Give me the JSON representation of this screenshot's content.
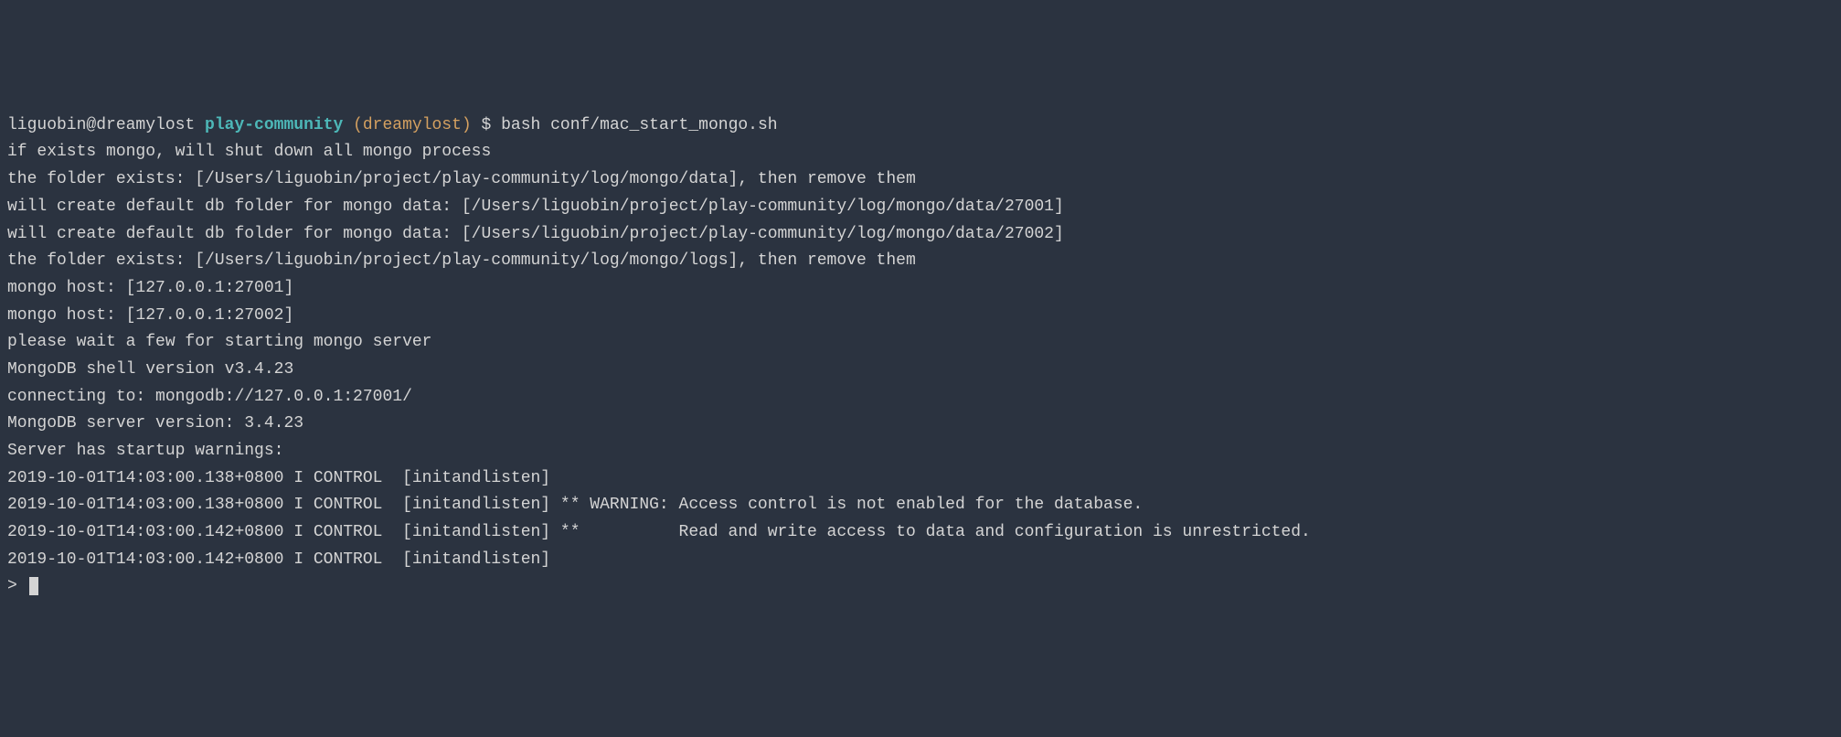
{
  "prompt": {
    "user_host": "liguobin@dreamylost ",
    "directory": "play-community",
    "branch": " (dreamylost)",
    "dollar": " $ ",
    "command": "bash conf/mac_start_mongo.sh"
  },
  "output": {
    "lines": [
      "if exists mongo, will shut down all mongo process",
      "the folder exists: [/Users/liguobin/project/play-community/log/mongo/data], then remove them",
      "will create default db folder for mongo data: [/Users/liguobin/project/play-community/log/mongo/data/27001]",
      "will create default db folder for mongo data: [/Users/liguobin/project/play-community/log/mongo/data/27002]",
      "the folder exists: [/Users/liguobin/project/play-community/log/mongo/logs], then remove them",
      "mongo host: [127.0.0.1:27001]",
      "mongo host: [127.0.0.1:27002]",
      "please wait a few for starting mongo server",
      "MongoDB shell version v3.4.23",
      "connecting to: mongodb://127.0.0.1:27001/",
      "MongoDB server version: 3.4.23",
      "Server has startup warnings: ",
      "2019-10-01T14:03:00.138+0800 I CONTROL  [initandlisten] ",
      "2019-10-01T14:03:00.138+0800 I CONTROL  [initandlisten] ** WARNING: Access control is not enabled for the database.",
      "2019-10-01T14:03:00.142+0800 I CONTROL  [initandlisten] **          Read and write access to data and configuration is unrestricted.",
      "2019-10-01T14:03:00.142+0800 I CONTROL  [initandlisten] "
    ]
  },
  "final_prompt": "> "
}
